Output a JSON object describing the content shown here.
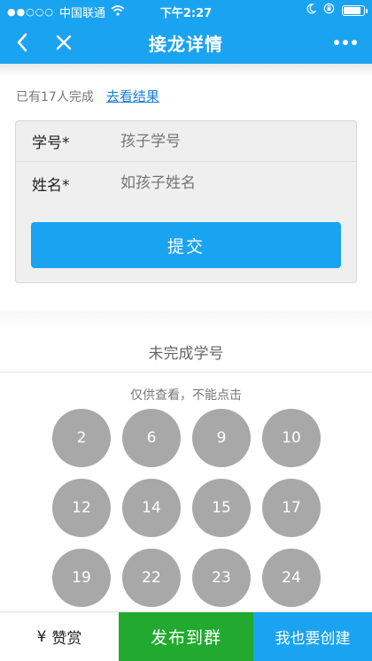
{
  "status_bar": {
    "signal": "●●○○○",
    "carrier": "中国联通",
    "time": "下午2:27"
  },
  "nav": {
    "title": "接龙详情"
  },
  "progress": {
    "count_text": "已有17人完成",
    "link_text": "去看结果"
  },
  "form": {
    "fields": [
      {
        "label": "学号*",
        "placeholder": "孩子学号"
      },
      {
        "label": "姓名*",
        "placeholder": "如孩子姓名"
      }
    ],
    "submit_label": "提交"
  },
  "incomplete": {
    "title": "未完成学号",
    "hint": "仅供查看，不能点击",
    "ids": [
      "2",
      "6",
      "9",
      "10",
      "12",
      "14",
      "15",
      "17",
      "19",
      "22",
      "23",
      "24"
    ]
  },
  "bottom_bar": {
    "reward_icon": "¥",
    "reward_label": "赞赏",
    "publish_label": "发布到群",
    "create_label": "我也要创建"
  },
  "colors": {
    "brand_blue": "#1aa3f0",
    "publish_green": "#21aa2f",
    "circle_gray": "#a8a8a8"
  }
}
